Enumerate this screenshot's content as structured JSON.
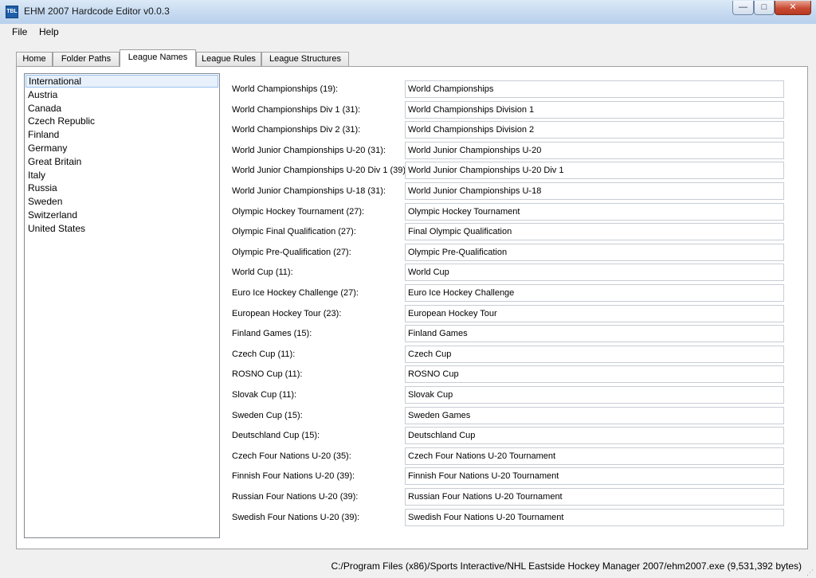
{
  "window": {
    "title": "EHM 2007 Hardcode Editor v0.0.3",
    "app_icon_text": "TBL",
    "buttons": {
      "minimize": "—",
      "maximize": "□",
      "close": "✕"
    }
  },
  "menu": {
    "items": [
      "File",
      "Help"
    ]
  },
  "tabs": [
    {
      "label": "Home"
    },
    {
      "label": "Folder Paths"
    },
    {
      "label": "League Names",
      "active": true
    },
    {
      "label": "League Rules"
    },
    {
      "label": "League Structures"
    }
  ],
  "countries": {
    "selected": "International",
    "items": [
      "International",
      "Austria",
      "Canada",
      "Czech Republic",
      "Finland",
      "Germany",
      "Great Britain",
      "Italy",
      "Russia",
      "Sweden",
      "Switzerland",
      "United States"
    ]
  },
  "league_names": [
    {
      "label": "World Championships (19):",
      "value": "World Championships"
    },
    {
      "label": "World Championships Div 1 (31):",
      "value": "World Championships Division 1"
    },
    {
      "label": "World Championships Div 2 (31):",
      "value": "World Championships Division 2"
    },
    {
      "label": "World Junior Championships U-20 (31):",
      "value": "World Junior Championships U-20"
    },
    {
      "label": "World Junior Championships U-20 Div 1 (39):",
      "value": "World Junior Championships U-20 Div 1"
    },
    {
      "label": "World Junior Championships U-18 (31):",
      "value": "World Junior Championships U-18"
    },
    {
      "label": "Olympic Hockey Tournament (27):",
      "value": "Olympic Hockey Tournament"
    },
    {
      "label": "Olympic Final Qualification (27):",
      "value": "Final Olympic Qualification"
    },
    {
      "label": "Olympic Pre-Qualification (27):",
      "value": "Olympic Pre-Qualification"
    },
    {
      "label": "World Cup (11):",
      "value": "World Cup"
    },
    {
      "label": "Euro Ice Hockey Challenge (27):",
      "value": "Euro Ice Hockey Challenge"
    },
    {
      "label": "European Hockey Tour (23):",
      "value": "European Hockey Tour"
    },
    {
      "label": "Finland Games (15):",
      "value": "Finland Games"
    },
    {
      "label": "Czech Cup (11):",
      "value": "Czech Cup"
    },
    {
      "label": "ROSNO Cup (11):",
      "value": "ROSNO Cup"
    },
    {
      "label": "Slovak Cup (11):",
      "value": "Slovak Cup"
    },
    {
      "label": "Sweden Cup (15):",
      "value": "Sweden Games"
    },
    {
      "label": "Deutschland Cup (15):",
      "value": "Deutschland Cup"
    },
    {
      "label": "Czech Four Nations U-20 (35):",
      "value": "Czech Four Nations U-20 Tournament"
    },
    {
      "label": "Finnish Four Nations U-20 (39):",
      "value": "Finnish Four Nations U-20 Tournament"
    },
    {
      "label": "Russian Four Nations U-20 (39):",
      "value": "Russian Four Nations U-20 Tournament"
    },
    {
      "label": "Swedish Four Nations U-20 (39):",
      "value": "Swedish Four Nations U-20 Tournament"
    }
  ],
  "status": {
    "path": "C:/Program Files (x86)/Sports Interactive/NHL Eastside Hockey Manager 2007/ehm2007.exe (9,531,392 bytes)"
  }
}
